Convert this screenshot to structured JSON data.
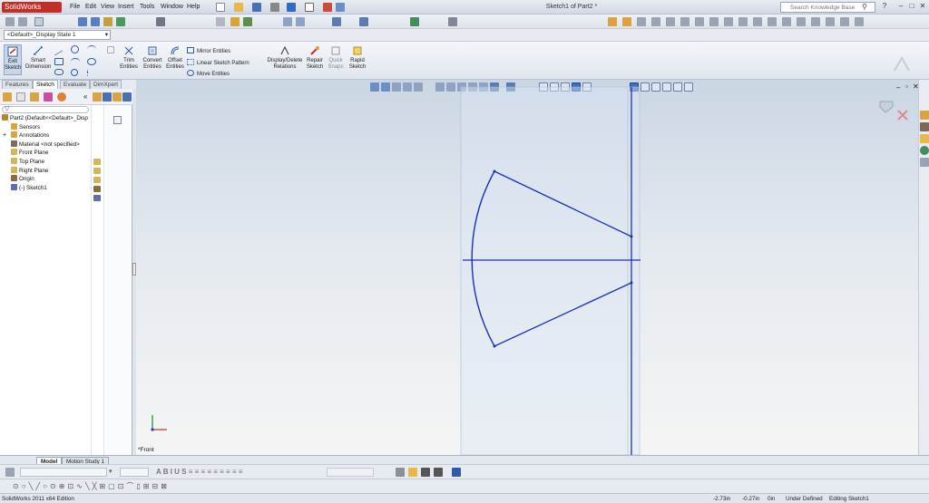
{
  "app": {
    "logo_text": "SolidWorks",
    "window_title": "Sketch1 of Part2 *"
  },
  "menus": [
    "File",
    "Edit",
    "View",
    "Insert",
    "Tools",
    "Window",
    "Help"
  ],
  "search": {
    "placeholder": "Search Knowledge Base"
  },
  "window_controls": {
    "minimize": "–",
    "maximize": "□",
    "close": "✕",
    "help": "?"
  },
  "config": {
    "selected": "<Default>_Display State 1"
  },
  "command_manager": {
    "exit_sketch": "Exit Sketch",
    "smart_dimension": "Smart Dimension",
    "trim_entities": "Trim Entities",
    "convert_entities": "Convert Entities",
    "offset_entities": "Offset Entities",
    "mirror_entities": "Mirror Entities",
    "linear_pattern": "Linear Sketch Pattern",
    "move_entities": "Move Entities",
    "display_delete_relations": "Display/Delete Relations",
    "repair_sketch": "Repair Sketch",
    "quick_snaps": "Quick Snaps",
    "rapid_sketch": "Rapid Sketch"
  },
  "tabs": [
    "Features",
    "Sketch",
    "Evaluate",
    "DimXpert"
  ],
  "active_tab": "Sketch",
  "feature_tree": [
    {
      "label": "Part2  (Default<<Default>_Disp",
      "icon": "part-icon",
      "color": "#b8862b"
    },
    {
      "label": "Sensors",
      "icon": "sensor-icon",
      "color": "#d9a441"
    },
    {
      "label": "Annotations",
      "icon": "annotation-icon",
      "color": "#d9a441"
    },
    {
      "label": "Material <not specified>",
      "icon": "material-icon",
      "color": "#7b6a5a"
    },
    {
      "label": "Front Plane",
      "icon": "plane-icon",
      "color": "#d3b65a"
    },
    {
      "label": "Top Plane",
      "icon": "plane-icon",
      "color": "#d3b65a"
    },
    {
      "label": "Right Plane",
      "icon": "plane-icon",
      "color": "#d3b65a"
    },
    {
      "label": "Origin",
      "icon": "origin-icon",
      "color": "#8a6d3b"
    },
    {
      "label": "(-) Sketch1",
      "icon": "sketch-icon",
      "color": "#5a6fb0"
    }
  ],
  "graphics": {
    "view_label": "*Front",
    "sketch_color": "#1a2fbf"
  },
  "bottom_tabs": [
    "Model",
    "Motion Study 1"
  ],
  "status": {
    "edition": "SolidWorks 2011 x64 Edition",
    "x": "-2.73in",
    "y": "-0.27in",
    "z": "0in",
    "state": "Under Defined",
    "editing": "Editing Sketch1"
  },
  "colors": {
    "accent": "#c0302a",
    "chrome": "#dfe3ea",
    "sketch": "#1a2fbf"
  }
}
